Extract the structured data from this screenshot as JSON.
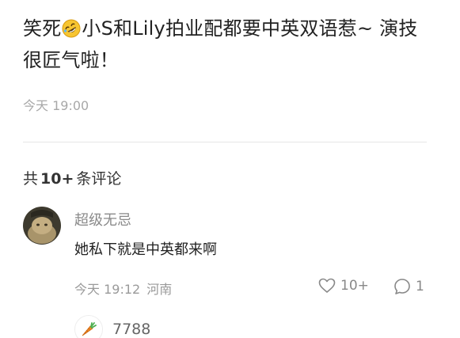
{
  "post": {
    "text_before_emoji": "笑死",
    "text_after_emoji": "小S和Lily拍业配都要中英双语惹~ 演技很匠气啦！",
    "emoji_icon": "rolling-on-floor-laughing-icon",
    "time": "今天 19:00"
  },
  "comments_header": {
    "prefix": "共",
    "count": "10+",
    "suffix": "条评论"
  },
  "comment": {
    "username": "超级无忌",
    "text": "她私下就是中英都来啊",
    "time": "今天 19:12",
    "location": "河南",
    "likes": "10+",
    "replies": "1",
    "avatar_icon": "user-avatar"
  },
  "bottom": {
    "icon": "carrot-icon",
    "count": "7788"
  },
  "colors": {
    "text_primary": "#222222",
    "text_secondary": "#8a8a8a",
    "divider": "#e6e6e6",
    "emoji_yellow": "#f7c531"
  }
}
